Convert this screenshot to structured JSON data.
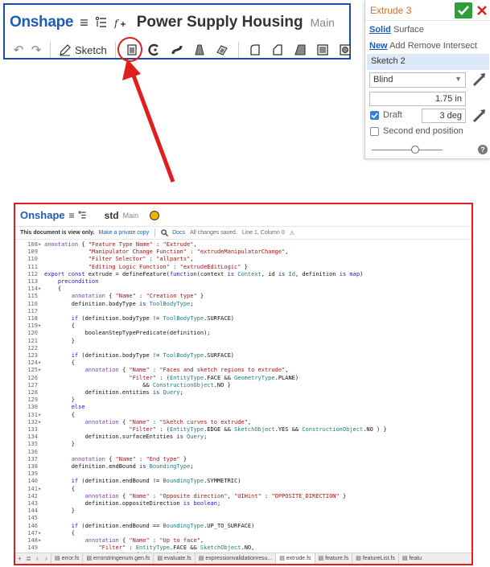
{
  "toolbar": {
    "logo": "Onshape",
    "document_title": "Power Supply Housing",
    "branch": "Main",
    "sketch_label": "Sketch"
  },
  "panel": {
    "title": "Extrude 3",
    "solid": "Solid",
    "surface": "Surface",
    "new": "New",
    "add": "Add",
    "remove": "Remove",
    "intersect": "Intersect",
    "sketch_selection": "Sketch 2",
    "end_type": "Blind",
    "depth": "1.75 in",
    "draft_label": "Draft",
    "draft_angle": "3 deg",
    "second_end_label": "Second end position",
    "draft_checked": true,
    "second_end_checked": false,
    "slider_level": 0.6,
    "help": "?"
  },
  "editor": {
    "logo": "Onshape",
    "document_title": "std",
    "branch": "Main",
    "view_only_notice": "This document is view only.",
    "make_private_copy": "Make a private copy",
    "docs": "Docs",
    "save_status": "All changes saved.",
    "cursor_position": "Line 1, Column 0",
    "lines": [
      {
        "n": "108",
        "fold": "▾",
        "t": "annotation { \"Feature Type Name\" : \"Extrude\","
      },
      {
        "n": "109",
        "fold": "",
        "t": "             \"Manipulator Change Function\" : \"extrudeManipulatorChange\","
      },
      {
        "n": "110",
        "fold": "",
        "t": "             \"Filter Selector\" : \"allparts\","
      },
      {
        "n": "111",
        "fold": "",
        "t": "             \"Editing Logic Function\" : \"extrudeEditLogic\" }"
      },
      {
        "n": "112",
        "fold": "",
        "t": "export const extrude = defineFeature(function(context is Context, id is Id, definition is map)"
      },
      {
        "n": "113",
        "fold": "",
        "t": "    precondition"
      },
      {
        "n": "114",
        "fold": "▾",
        "t": "    {"
      },
      {
        "n": "115",
        "fold": "",
        "t": "        annotation { \"Name\" : \"Creation type\" }"
      },
      {
        "n": "116",
        "fold": "",
        "t": "        definition.bodyType is ToolBodyType;"
      },
      {
        "n": "117",
        "fold": "",
        "t": ""
      },
      {
        "n": "118",
        "fold": "",
        "t": "        if (definition.bodyType != ToolBodyType.SURFACE)"
      },
      {
        "n": "119",
        "fold": "▾",
        "t": "        {"
      },
      {
        "n": "120",
        "fold": "",
        "t": "            booleanStepTypePredicate(definition);"
      },
      {
        "n": "121",
        "fold": "",
        "t": "        }"
      },
      {
        "n": "122",
        "fold": "",
        "t": ""
      },
      {
        "n": "123",
        "fold": "",
        "t": "        if (definition.bodyType != ToolBodyType.SURFACE)"
      },
      {
        "n": "124",
        "fold": "▾",
        "t": "        {"
      },
      {
        "n": "125",
        "fold": "▾",
        "t": "            annotation { \"Name\" : \"Faces and sketch regions to extrude\","
      },
      {
        "n": "126",
        "fold": "",
        "t": "                         \"Filter\" : (EntityType.FACE && GeometryType.PLANE)"
      },
      {
        "n": "127",
        "fold": "",
        "t": "                             && ConstructionObject.NO }"
      },
      {
        "n": "128",
        "fold": "",
        "t": "            definition.entities is Query;"
      },
      {
        "n": "129",
        "fold": "",
        "t": "        }"
      },
      {
        "n": "130",
        "fold": "",
        "t": "        else"
      },
      {
        "n": "131",
        "fold": "▾",
        "t": "        {"
      },
      {
        "n": "132",
        "fold": "▾",
        "t": "            annotation { \"Name\" : \"Sketch curves to extrude\","
      },
      {
        "n": "133",
        "fold": "",
        "t": "                         \"Filter\" : (EntityType.EDGE && SketchObject.YES && ConstructionObject.NO ) }"
      },
      {
        "n": "134",
        "fold": "",
        "t": "            definition.surfaceEntities is Query;"
      },
      {
        "n": "135",
        "fold": "",
        "t": "        }"
      },
      {
        "n": "136",
        "fold": "",
        "t": ""
      },
      {
        "n": "137",
        "fold": "",
        "t": "        annotation { \"Name\" : \"End type\" }"
      },
      {
        "n": "138",
        "fold": "",
        "t": "        definition.endBound is BoundingType;"
      },
      {
        "n": "139",
        "fold": "",
        "t": ""
      },
      {
        "n": "140",
        "fold": "",
        "t": "        if (definition.endBound != BoundingType.SYMMETRIC)"
      },
      {
        "n": "141",
        "fold": "▾",
        "t": "        {"
      },
      {
        "n": "142",
        "fold": "",
        "t": "            annotation { \"Name\" : \"Opposite direction\", \"UIHint\" : \"OPPOSITE_DIRECTION\" }"
      },
      {
        "n": "143",
        "fold": "",
        "t": "            definition.oppositeDirection is boolean;"
      },
      {
        "n": "144",
        "fold": "",
        "t": "        }"
      },
      {
        "n": "145",
        "fold": "",
        "t": ""
      },
      {
        "n": "146",
        "fold": "",
        "t": "        if (definition.endBound == BoundingType.UP_TO_SURFACE)"
      },
      {
        "n": "147",
        "fold": "▾",
        "t": "        {"
      },
      {
        "n": "148",
        "fold": "▾",
        "t": "            annotation { \"Name\" : \"Up to face\","
      },
      {
        "n": "149",
        "fold": "",
        "t": "                \"Filter\" : EntityType.FACE && SketchObject.NO,"
      },
      {
        "n": "150",
        "fold": "",
        "t": "                \"MaxNumberOfPicks\" : 1 }"
      },
      {
        "n": "151",
        "fold": "",
        "t": "            definition.endBoundEntityFace is Query;"
      }
    ],
    "tabs": [
      "error.fs",
      "errorstringenum.gen.fs",
      "evaluate.fs",
      "expressionvalidationresu...",
      "extrude.fs",
      "feature.fs",
      "featureList.fs",
      "featu"
    ],
    "active_tab": "extrude.fs"
  },
  "colors": {
    "brand_blue": "#1d5db8",
    "highlight_red": "#e01e1e",
    "title_orange": "#e06a1b",
    "ok_green": "#2e9e3c",
    "keyword_blue": "#1a1ab8",
    "string_red": "#a31515",
    "annotation_purple": "#7a3fa8",
    "type_teal": "#1f7a7a"
  },
  "icons": {
    "toolbar": [
      "hamburger-menu-icon",
      "feature-list-icon",
      "add-custom-feature-icon",
      "undo-icon",
      "redo-icon",
      "sketch-pencil-icon",
      "extrude-icon",
      "revolve-icon",
      "sweep-icon",
      "loft-icon",
      "thicken-icon",
      "fillet-icon",
      "chamfer-icon",
      "draft-icon",
      "shell-icon",
      "hole-icon"
    ],
    "panel": [
      "confirm-check-icon",
      "cancel-x-icon",
      "flip-direction-icon"
    ],
    "editor": [
      "hamburger-menu-icon",
      "feature-list-icon",
      "warning-icon",
      "search-icon",
      "add-tab-icon",
      "tab-list-icon",
      "tab-left-icon",
      "tab-right-icon"
    ]
  }
}
